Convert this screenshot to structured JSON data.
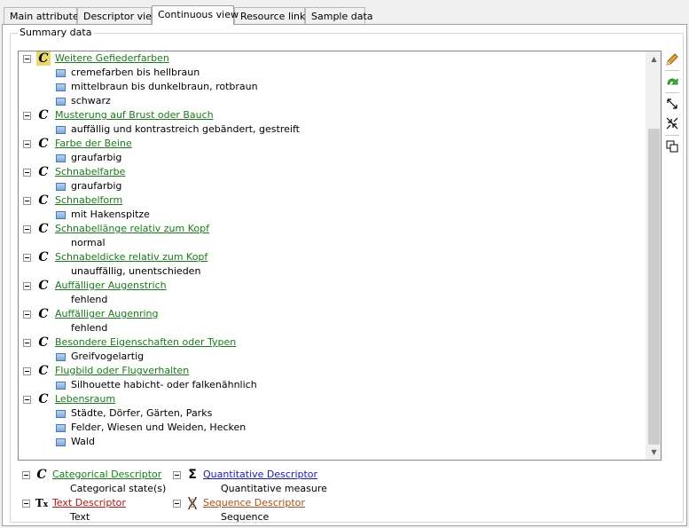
{
  "tabs": [
    {
      "label": "Main attributes",
      "active": false
    },
    {
      "label": "Descriptor view",
      "active": false
    },
    {
      "label": "Continuous view",
      "active": true
    },
    {
      "label": "Resource links",
      "active": false
    },
    {
      "label": "Sample data",
      "active": false
    }
  ],
  "groupbox": {
    "title": "Summary data"
  },
  "tree": {
    "descriptors": [
      {
        "name": "Weitere Gefiederfarben",
        "selected": true,
        "states": [
          {
            "text": "cremefarben bis hellbraun",
            "icon": true
          },
          {
            "text": "mittelbraun bis dunkelbraun, rotbraun",
            "icon": true
          },
          {
            "text": "schwarz",
            "icon": true
          }
        ]
      },
      {
        "name": "Musterung auf Brust oder Bauch",
        "selected": false,
        "states": [
          {
            "text": "auffällig und kontrastreich gebändert, gestreift",
            "icon": true
          }
        ]
      },
      {
        "name": "Farbe der Beine",
        "selected": false,
        "states": [
          {
            "text": "graufarbig",
            "icon": true
          }
        ]
      },
      {
        "name": "Schnabelfarbe",
        "selected": false,
        "states": [
          {
            "text": "graufarbig",
            "icon": true
          }
        ]
      },
      {
        "name": "Schnabelform",
        "selected": false,
        "states": [
          {
            "text": "mit Hakenspitze",
            "icon": true
          }
        ]
      },
      {
        "name": "Schnabellänge relativ zum Kopf",
        "selected": false,
        "states": [
          {
            "text": "normal",
            "icon": false
          }
        ]
      },
      {
        "name": "Schnabeldicke relativ zum Kopf",
        "selected": false,
        "states": [
          {
            "text": "unauffällig, unentschieden",
            "icon": false
          }
        ]
      },
      {
        "name": "Auffälliger Augenstrich",
        "selected": false,
        "states": [
          {
            "text": "fehlend",
            "icon": false
          }
        ]
      },
      {
        "name": "Auffälliger Augenring",
        "selected": false,
        "states": [
          {
            "text": "fehlend",
            "icon": false
          }
        ]
      },
      {
        "name": "Besondere Eigenschaften oder Typen",
        "selected": false,
        "states": [
          {
            "text": "Greifvogelartig",
            "icon": true
          }
        ]
      },
      {
        "name": "Flugbild oder Flugverhalten",
        "selected": false,
        "states": [
          {
            "text": "Silhouette habicht- oder falkenähnlich",
            "icon": true
          }
        ]
      },
      {
        "name": "Lebensraum",
        "selected": false,
        "states": [
          {
            "text": "Städte, Dörfer, Gärten, Parks",
            "icon": true
          },
          {
            "text": "Felder, Wiesen und Weiden, Hecken",
            "icon": true
          },
          {
            "text": "Wald",
            "icon": true
          }
        ]
      }
    ]
  },
  "toolbar": {
    "icons": [
      "pencil-icon",
      "undo-arrow-icon",
      "expand-icon",
      "collapse-icon",
      "copy-icon"
    ]
  },
  "legend": {
    "categorical": {
      "label": "Categorical Descriptor",
      "sub": "Categorical state(s)",
      "color": "#1a7a1a"
    },
    "quantitative": {
      "label": "Quantitative Descriptor",
      "sub": "Quantitative measure",
      "color": "#1a1aa8"
    },
    "text": {
      "label": "Text Descriptor",
      "sub": "Text",
      "color": "#a81a1a"
    },
    "sequence": {
      "label": "Sequence Descriptor",
      "sub": "Sequence",
      "color": "#a0521a"
    }
  },
  "colors": {
    "link_green": "#1a7a1a",
    "selection_yellow": "#e6d86a",
    "state_icon_blue": "#7fa9da"
  }
}
